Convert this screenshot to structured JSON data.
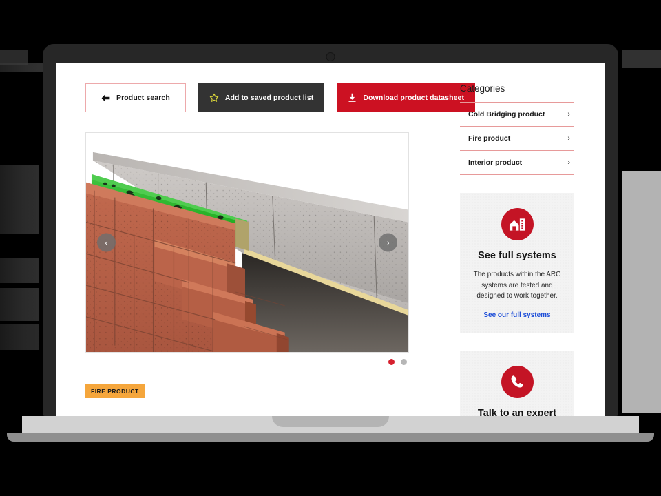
{
  "toolbar": {
    "back_button": {
      "label": "Product search",
      "icon": "arrow-left-icon"
    },
    "save_button": {
      "label": "Add to saved product list",
      "icon": "star-icon"
    },
    "download_button": {
      "label": "Download product datasheet",
      "icon": "download-icon"
    }
  },
  "carousel": {
    "prev_label": "‹",
    "next_label": "›",
    "slide_count": 2,
    "active_slide": 1,
    "image_alt": "Cavity wall cutaway with green fire barrier over insulation between brick and blockwork"
  },
  "badge": {
    "label": "FIRE PRODUCT",
    "color": "#f5a63c"
  },
  "sidebar": {
    "title": "Categories",
    "categories": [
      {
        "label": "Cold Bridging product",
        "chevron": "›"
      },
      {
        "label": "Fire product",
        "chevron": "›"
      },
      {
        "label": "Interior product",
        "chevron": "›"
      }
    ],
    "cards": [
      {
        "icon": "house-building-icon",
        "title": "See full systems",
        "body": "The products within the ARC systems are tested and designed to work together.",
        "link": "See our full systems"
      },
      {
        "icon": "phone-icon",
        "title": "Talk to an expert",
        "body": "",
        "link": ""
      }
    ]
  },
  "theme": {
    "brand_red": "#cc1122",
    "icon_red": "#c41425",
    "dark_button": "#333333",
    "link_blue": "#1f4fd8",
    "rule_pink": "#e79a9a",
    "badge_orange": "#f5a63c",
    "bezel": "#272727"
  }
}
